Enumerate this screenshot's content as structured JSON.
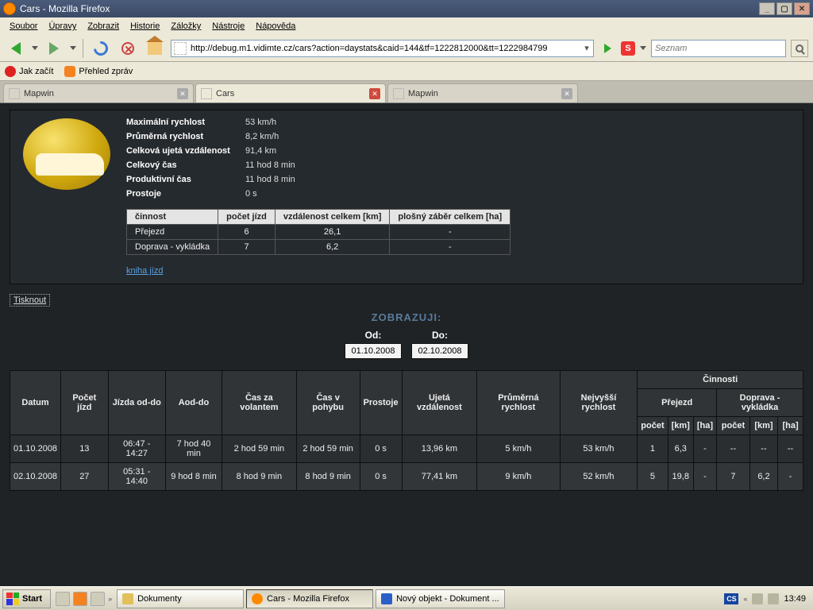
{
  "window": {
    "title": "Cars - Mozilla Firefox"
  },
  "menubar": [
    "Soubor",
    "Úpravy",
    "Zobrazit",
    "Historie",
    "Záložky",
    "Nástroje",
    "Nápověda"
  ],
  "url": "http://debug.m1.vidimte.cz/cars?action=daystats&caid=144&tf=1222812000&tt=1222984799",
  "search": {
    "placeholder": "Seznam",
    "engine": "S"
  },
  "bookmarks": {
    "b1": "Jak začít",
    "b2": "Přehled zpráv"
  },
  "tabs": {
    "t1": "Mapwin",
    "t2": "Cars",
    "t3": "Mapwin"
  },
  "summary": {
    "max_speed": {
      "label": "Maximální rychlost",
      "val": "53 km/h"
    },
    "avg_speed": {
      "label": "Průměrná rychlost",
      "val": "8,2 km/h"
    },
    "distance": {
      "label": "Celková ujetá vzdálenost",
      "val": "91,4 km"
    },
    "total_time": {
      "label": "Celkový čas",
      "val": "11 hod 8 min"
    },
    "prod_time": {
      "label": "Produktivní čas",
      "val": "11 hod 8 min"
    },
    "idle": {
      "label": "Prostoje",
      "val": "0 s"
    }
  },
  "activities": {
    "headers": {
      "act": "činnost",
      "count": "počet jízd",
      "dist": "vzdálenost celkem [km]",
      "area": "plošný záběr celkem [ha]"
    },
    "r1": {
      "act": "Přejezd",
      "count": "6",
      "dist": "26,1",
      "area": "-"
    },
    "r2": {
      "act": "Doprava - vykládka",
      "count": "7",
      "dist": "6,2",
      "area": "-"
    }
  },
  "links": {
    "book": "kniha jízd",
    "print": "Tisknout"
  },
  "show": {
    "title": "ZOBRAZUJI:",
    "od_label": "Od:",
    "do_label": "Do:",
    "od": "01.10.2008",
    "do": "02.10.2008"
  },
  "table": {
    "headers": {
      "date": "Datum",
      "trips": "Počet jízd",
      "ride": "Jízda od-do",
      "aod": "Aod-do",
      "wheel": "Čas za volantem",
      "moving": "Čas v pohybu",
      "idle": "Prostoje",
      "dist": "Ujetá vzdálenost",
      "avg": "Průměrná rychlost",
      "max": "Nejvyšší rychlost",
      "acts": "Činnosti",
      "act1": "Přejezd",
      "act2": "Doprava - vykládka",
      "sub_count": "počet",
      "sub_km": "[km]",
      "sub_ha": "[ha]"
    },
    "r1": {
      "date": "01.10.2008",
      "trips": "13",
      "ride": "06:47 - 14:27",
      "aod": "7 hod 40 min",
      "wheel": "2 hod 59 min",
      "moving": "2 hod 59 min",
      "idle": "0 s",
      "dist": "13,96 km",
      "avg": "5 km/h",
      "max": "53 km/h",
      "a1c": "1",
      "a1k": "6,3",
      "a1h": "-",
      "a2c": "--",
      "a2k": "--",
      "a2h": "--"
    },
    "r2": {
      "date": "02.10.2008",
      "trips": "27",
      "ride": "05:31 - 14:40",
      "aod": "9 hod 8 min",
      "wheel": "8 hod 9 min",
      "moving": "8 hod 9 min",
      "idle": "0 s",
      "dist": "77,41 km",
      "avg": "9 km/h",
      "max": "52 km/h",
      "a1c": "5",
      "a1k": "19,8",
      "a1h": "-",
      "a2c": "7",
      "a2k": "6,2",
      "a2h": "-"
    }
  },
  "taskbar": {
    "start": "Start",
    "t1": "Dokumenty",
    "t2": "Cars - Mozilla Firefox",
    "t3": "Nový objekt - Dokument ...",
    "lang": "CS",
    "time": "13:49"
  }
}
